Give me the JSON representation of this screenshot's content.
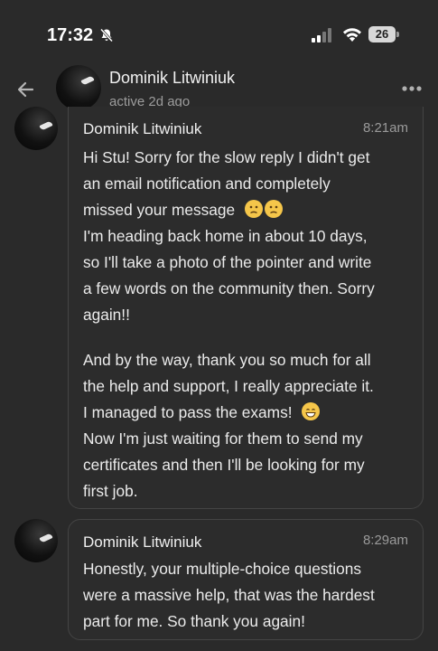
{
  "status_bar": {
    "time": "17:32",
    "battery": "26",
    "icons": [
      "bell-slash-icon",
      "signal-icon",
      "wifi-icon",
      "battery-icon"
    ]
  },
  "header": {
    "name": "Dominik Litwiniuk",
    "status": "active 2d ago",
    "icons": [
      "back-arrow-icon",
      "more-dots-icon"
    ]
  },
  "messages": [
    {
      "sender": "Dominik Litwiniuk",
      "time": "8:21am",
      "paragraphs": [
        {
          "lines": [
            "Hi Stu! Sorry for the slow reply I didn't get",
            "an email notification and completely",
            "missed your message"
          ],
          "emoji_after": [
            "confused-face-emoji",
            "confused-face-emoji"
          ]
        },
        {
          "lines": [
            "I'm heading back home in about 10 days,",
            "so I'll take a photo of the pointer and write",
            "a few words on the community then. Sorry",
            "again!!"
          ]
        },
        {
          "lines": [
            "And by the way, thank you so much for all",
            "the help and support, I really appreciate it.",
            "I managed to pass the exams!"
          ],
          "emoji_after": [
            "grinning-face-emoji"
          ]
        },
        {
          "lines": [
            "Now I'm just waiting for them to send my",
            "certificates and then I'll be looking for my",
            "first job."
          ]
        }
      ]
    },
    {
      "sender": "Dominik Litwiniuk",
      "time": "8:29am",
      "paragraphs": [
        {
          "lines": [
            "Honestly, your multiple-choice questions",
            "were a massive help, that was the hardest",
            "part for me. So thank you again!"
          ]
        }
      ]
    }
  ]
}
